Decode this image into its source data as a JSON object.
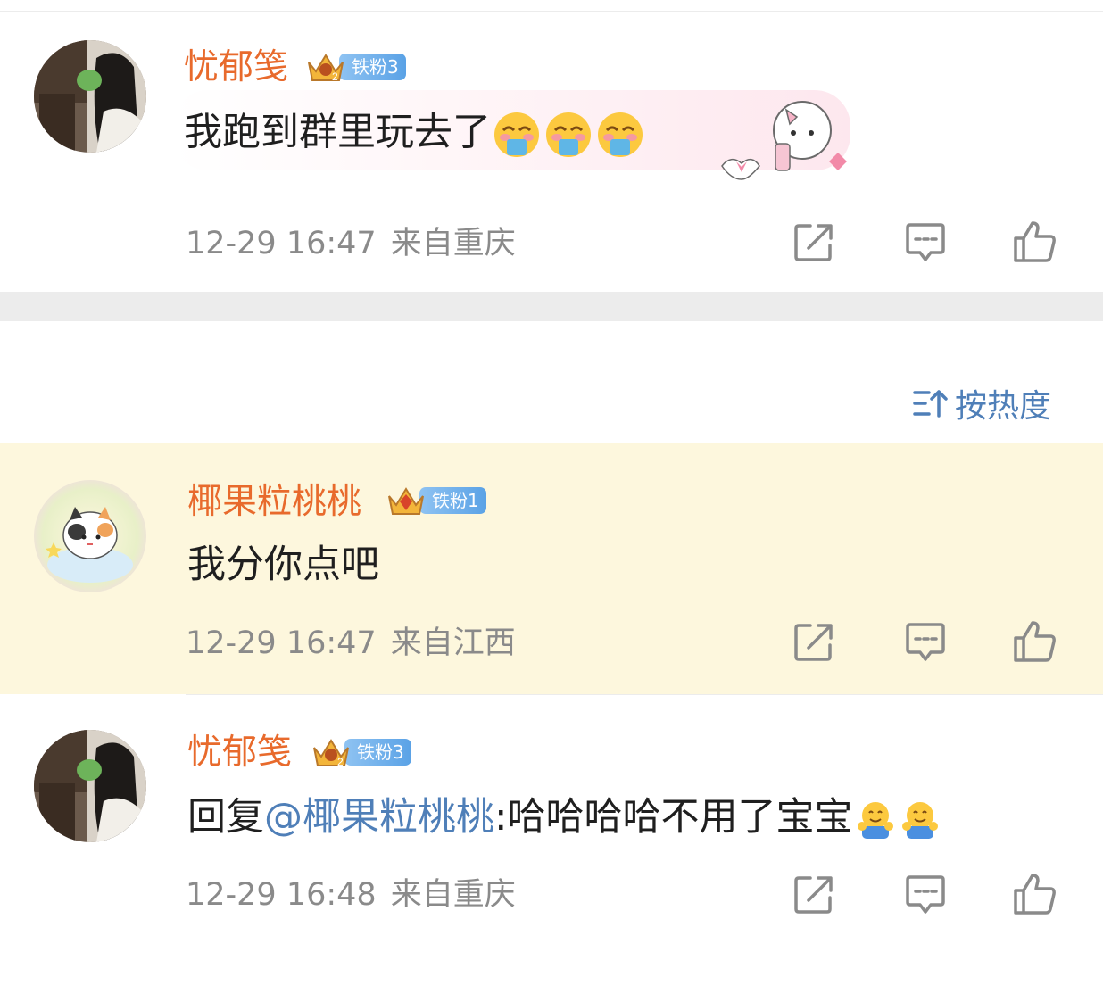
{
  "sort": {
    "label": "按热度",
    "icon": "sort-arrow-icon"
  },
  "comments": [
    {
      "username": "忧郁笺",
      "badge": {
        "label": "铁粉3",
        "crown_level": "2"
      },
      "text": "我跑到群里玩去了",
      "emoji": [
        "drooling-face-icon",
        "drooling-face-icon",
        "drooling-face-icon"
      ],
      "time": "12-29 16:47",
      "location": "来自重庆",
      "highlighted": false
    },
    {
      "username": "椰果粒桃桃",
      "badge": {
        "label": "铁粉1"
      },
      "text": "我分你点吧",
      "time": "12-29 16:47",
      "location": "来自江西",
      "highlighted": true
    },
    {
      "username": "忧郁笺",
      "badge": {
        "label": "铁粉3",
        "crown_level": "2"
      },
      "reply_prefix": "回复",
      "mention": "@椰果粒桃桃",
      "text": ":哈哈哈哈不用了宝宝",
      "emoji": [
        "hug-icon",
        "hug-icon"
      ],
      "time": "12-29 16:48",
      "location": "来自重庆",
      "highlighted": false
    }
  ],
  "actions": [
    "share-icon",
    "comment-icon",
    "like-icon"
  ],
  "colors": {
    "username": "#e86a2c",
    "mention": "#4f7fb8",
    "meta": "#8a8a8a",
    "highlight_bg": "#fdf7dd",
    "badge": "#5aa2e6"
  }
}
